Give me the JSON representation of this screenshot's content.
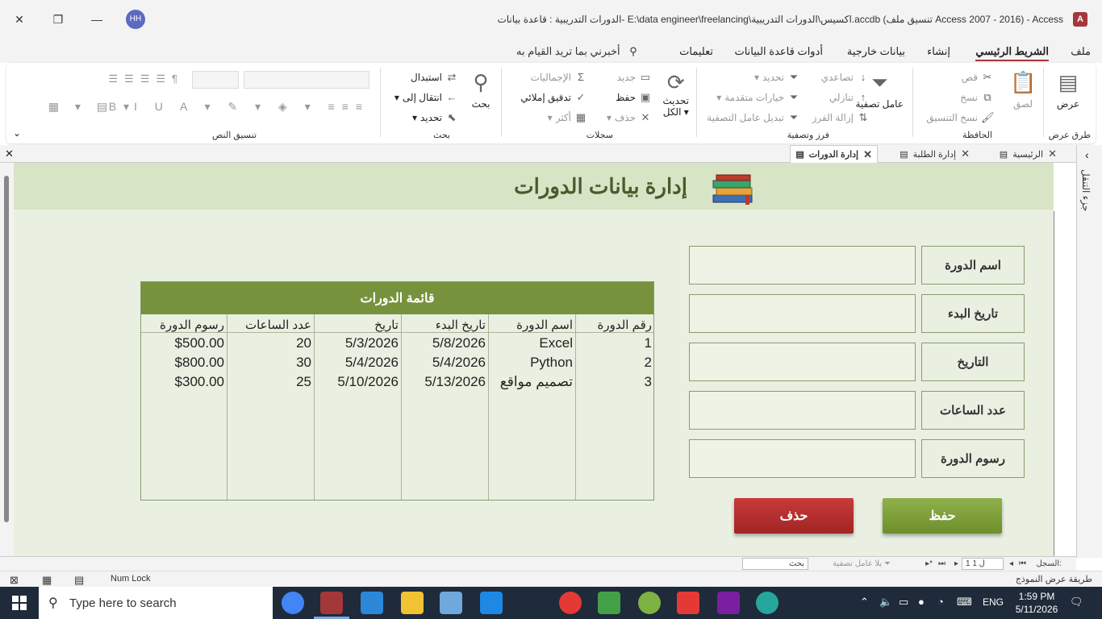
{
  "titlebar": {
    "title": "الدورات التدريبية : قاعدة بيانات- E:\\data engineer\\freelancing\\اكسيس\\الدورات التدريبية.accdb (تنسيق ملف Access 2007 - 2016)  -  Access",
    "avatar": "HH",
    "logo": "A"
  },
  "tabs": {
    "items": [
      "ملف",
      "الشريط الرئيسي",
      "إنشاء",
      "بيانات خارجية",
      "أدوات قاعدة البيانات",
      "تعليمات"
    ],
    "active": "الشريط الرئيسي",
    "tell_me": "أخبرني بما تريد القيام به"
  },
  "ribbon": {
    "views": {
      "view": "عرض",
      "group": "طرق عرض"
    },
    "clipboard": {
      "paste": "لصق",
      "cut": "قص",
      "copy": "نسخ",
      "format_painter": "نسخ التنسيق",
      "group": "الحافظة"
    },
    "sort_filter": {
      "filter": "عامل تصفية",
      "ascending": "تصاعدي",
      "descending": "تنازلي",
      "remove_sort": "إزالة الفرز",
      "selection": "تحديد",
      "advanced": "خيارات متقدمة",
      "toggle_filter": "تبديل عامل التصفية",
      "group": "فرز وتصفية"
    },
    "records": {
      "refresh": "تحديث",
      "refresh_all": "الكل",
      "new": "جديد",
      "save": "حفظ",
      "delete": "حذف",
      "totals": "الإجماليات",
      "spelling": "تدقيق إملائي",
      "more": "أكثر",
      "group": "سجلات"
    },
    "find": {
      "find": "بحث",
      "replace": "استبدال",
      "goto": "انتقال إلى",
      "select": "تحديد",
      "group": "بحث"
    },
    "text_format": {
      "group": "تنسيق النص"
    }
  },
  "doctabs": [
    {
      "label": "الرئيسية"
    },
    {
      "label": "إدارة الطلبة"
    },
    {
      "label": "إدارة الدورات"
    }
  ],
  "navpane": {
    "label": "جزء التنقل"
  },
  "form": {
    "title": "إدارة بيانات الدورات",
    "fields": [
      {
        "label": "اسم الدورة",
        "value": ""
      },
      {
        "label": "تاريخ البدء",
        "value": ""
      },
      {
        "label": "التاريخ",
        "value": ""
      },
      {
        "label": "عدد الساعات",
        "value": ""
      },
      {
        "label": "رسوم الدورة",
        "value": ""
      }
    ],
    "save_label": "حفظ",
    "delete_label": "حذف"
  },
  "listbox": {
    "title": "قائمة الدورات",
    "columns": [
      "رقم الدورة",
      "اسم الدورة",
      "تاريخ البدء",
      "تاريخ",
      "عدد الساعات",
      "رسوم الدورة"
    ],
    "rows": [
      [
        "1",
        "Excel",
        "5/8/2026",
        "5/3/2026",
        "20",
        "$500.00"
      ],
      [
        "2",
        "Python",
        "5/4/2026",
        "5/4/2026",
        "30",
        "$800.00"
      ],
      [
        "3",
        "تصميم مواقع",
        "5/13/2026",
        "5/10/2026",
        "25",
        "$300.00"
      ]
    ]
  },
  "recnav": {
    "record_label": "السجل:",
    "record_value": "1 ل 1",
    "no_filter": "بلا عامل تصفية",
    "search": "بحث"
  },
  "statusbar": {
    "view_mode": "طريقة عرض النموذج",
    "numlock": "Num Lock"
  },
  "taskbar": {
    "search_placeholder": "Type here to search",
    "lang": "ENG",
    "time": "1:59 PM",
    "date": "5/11/2026"
  }
}
